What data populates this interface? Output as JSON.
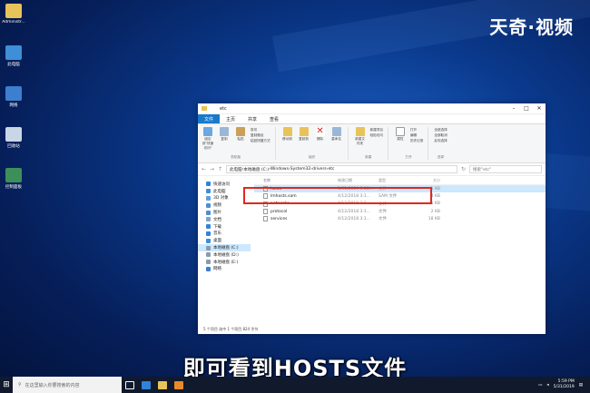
{
  "watermark": "天奇·视频",
  "desktop_icons": [
    {
      "label": "Administr...",
      "icon": "user-folder-icon",
      "color": "#e8c35a"
    },
    {
      "label": "此电脑",
      "icon": "this-pc-icon",
      "color": "#3e8ed8"
    },
    {
      "label": "网络",
      "icon": "network-icon",
      "color": "#3c7fcf"
    },
    {
      "label": "回收站",
      "icon": "recycle-bin-icon",
      "color": "#c8d6e6"
    },
    {
      "label": "控制面板",
      "icon": "control-panel-icon",
      "color": "#3d8f5a"
    }
  ],
  "window": {
    "title": "etc",
    "tabs": [
      "文件",
      "主页",
      "共享",
      "查看"
    ],
    "ribbon": {
      "pin_label": "固定到\"快速访问\"",
      "copy_label": "复制",
      "paste_label": "粘贴",
      "cut_label": "剪切",
      "copy_path_label": "复制路径",
      "paste_shortcut_label": "粘贴快捷方式",
      "clipboard_group": "剪贴板",
      "move_to_label": "移动到",
      "copy_to_label": "复制到",
      "delete_label": "删除",
      "rename_label": "重命名",
      "organize_group": "组织",
      "new_folder_label": "新建文件夹",
      "new_item_label": "新建项目",
      "easy_access_label": "轻松访问",
      "new_group": "新建",
      "properties_label": "属性",
      "open_label": "打开",
      "edit_label": "编辑",
      "history_label": "历史记录",
      "open_group": "打开",
      "select_all_label": "全部选择",
      "select_none_label": "全部取消",
      "invert_label": "反向选择",
      "select_group": "选择"
    },
    "address": {
      "path": [
        "此电脑",
        "本地磁盘 (C:)",
        "Windows",
        "System32",
        "drivers",
        "etc"
      ],
      "search_placeholder": "搜索\"etc\""
    },
    "nav_items": [
      {
        "label": "快速访问",
        "icon": "star-icon",
        "color": "#2f84d8"
      },
      {
        "label": "此电脑",
        "icon": "this-pc-icon",
        "color": "#3e8ed8"
      },
      {
        "label": "3D 对象",
        "icon": "cube-icon",
        "color": "#5aa0e0"
      },
      {
        "label": "视频",
        "icon": "video-icon",
        "color": "#4a8fd4"
      },
      {
        "label": "图片",
        "icon": "picture-icon",
        "color": "#4a8fd4"
      },
      {
        "label": "文档",
        "icon": "document-icon",
        "color": "#7fa4cc"
      },
      {
        "label": "下载",
        "icon": "download-icon",
        "color": "#2f84d8"
      },
      {
        "label": "音乐",
        "icon": "music-icon",
        "color": "#2f84d8"
      },
      {
        "label": "桌面",
        "icon": "desktop-icon",
        "color": "#3e8ed8"
      },
      {
        "label": "本地磁盘 (C:)",
        "icon": "drive-icon",
        "color": "#8a9bb0"
      },
      {
        "label": "本地磁盘 (D:)",
        "icon": "drive-icon",
        "color": "#8a9bb0"
      },
      {
        "label": "本地磁盘 (E:)",
        "icon": "drive-icon",
        "color": "#8a9bb0"
      },
      {
        "label": "网络",
        "icon": "network-icon",
        "color": "#3c7fcf"
      }
    ],
    "columns": [
      "名称",
      "修改日期",
      "类型",
      "大小"
    ],
    "files": [
      {
        "name": "hosts",
        "date": "5/31/2019 5:58...",
        "type": "文件",
        "size": "1 KB",
        "selected": true
      },
      {
        "name": "lmhosts.sam",
        "date": "4/12/2018 3:1...",
        "type": "SAM 文件",
        "size": "4 KB",
        "selected": false
      },
      {
        "name": "networks",
        "date": "4/12/2018 3:1...",
        "type": "文件",
        "size": "1 KB",
        "selected": false
      },
      {
        "name": "protocol",
        "date": "4/12/2018 3:1...",
        "type": "文件",
        "size": "2 KB",
        "selected": false
      },
      {
        "name": "services",
        "date": "4/12/2018 3:1...",
        "type": "文件",
        "size": "18 KB",
        "selected": false
      }
    ],
    "status": "5 个项目  选中 1 个项目 824 字节"
  },
  "subtitle": "即可看到HOSTS文件",
  "taskbar": {
    "search_placeholder": "在这里输入你要搜索的内容",
    "time": "5:59 PM",
    "date": "5/31/2019"
  },
  "colors": {
    "accent": "#1979ca",
    "highlight_box": "#e0281e",
    "selection": "#cce8ff"
  }
}
